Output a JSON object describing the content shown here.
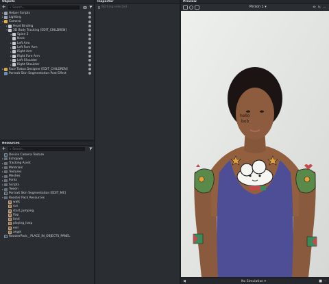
{
  "objects": {
    "title": "Objects",
    "search_placeholder": "Search...",
    "items": [
      {
        "label": "Helper Scripts",
        "indent": 0,
        "arrow": "▸",
        "color": "#9aa4b0"
      },
      {
        "label": "Lighting",
        "indent": 0,
        "arrow": "▸",
        "color": "#9aa4b0"
      },
      {
        "label": "Camera",
        "indent": 0,
        "arrow": "▾",
        "color": "#e0b04a"
      },
      {
        "label": "Head Binding",
        "indent": 1,
        "arrow": "▸",
        "color": "#c6cbd0"
      },
      {
        "label": "3D Body Tracking [EDIT_CHILDREN]",
        "indent": 1,
        "arrow": "▾",
        "color": "#c6cbd0"
      },
      {
        "label": "Spine 2",
        "indent": 2,
        "arrow": "▾",
        "color": "#c6cbd0"
      },
      {
        "label": "Neck",
        "indent": 2,
        "arrow": "",
        "color": "#c6cbd0"
      },
      {
        "label": "Left Arm",
        "indent": 2,
        "arrow": "▸",
        "color": "#c6cbd0"
      },
      {
        "label": "Left Fore Arm",
        "indent": 2,
        "arrow": "▸",
        "color": "#c6cbd0"
      },
      {
        "label": "Right Arm",
        "indent": 2,
        "arrow": "▸",
        "color": "#c6cbd0"
      },
      {
        "label": "Right Fore Arm",
        "indent": 2,
        "arrow": "▸",
        "color": "#c6cbd0"
      },
      {
        "label": "Left Shoulder",
        "indent": 2,
        "arrow": "▸",
        "color": "#c6cbd0"
      },
      {
        "label": "Right Shoulder",
        "indent": 2,
        "arrow": "▸",
        "color": "#c6cbd0"
      },
      {
        "label": "Face Tattoo Designer [EDIT_CHILDREN]",
        "indent": 0,
        "arrow": "▸",
        "color": "#d7a84a"
      },
      {
        "label": "Portrait Skin Segmentation Post Effect",
        "indent": 0,
        "arrow": "",
        "color": "#6b8fb8"
      }
    ]
  },
  "inspector": {
    "title": "Inspector",
    "empty_text": "Nothing selected"
  },
  "resources": {
    "title": "Resources",
    "search_placeholder": "Search...",
    "items": [
      {
        "label": "Device Camera Texture",
        "indent": 0,
        "arrow": "",
        "kind": "file"
      },
      {
        "label": "Echopark",
        "indent": 0,
        "arrow": "▸",
        "kind": "folder"
      },
      {
        "label": "Tracking Asset",
        "indent": 0,
        "arrow": "▸",
        "kind": "folder"
      },
      {
        "label": "Materials",
        "indent": 0,
        "arrow": "▸",
        "kind": "folder"
      },
      {
        "label": "Textures",
        "indent": 0,
        "arrow": "▸",
        "kind": "folder"
      },
      {
        "label": "Meshes",
        "indent": 0,
        "arrow": "▸",
        "kind": "folder"
      },
      {
        "label": "Fonts",
        "indent": 0,
        "arrow": "▸",
        "kind": "folder"
      },
      {
        "label": "Scripts",
        "indent": 0,
        "arrow": "▸",
        "kind": "folder"
      },
      {
        "label": "Tween",
        "indent": 0,
        "arrow": "▸",
        "kind": "folder"
      },
      {
        "label": "Portrait Skin Segmentation [EDIT_ME]",
        "indent": 0,
        "arrow": "",
        "kind": "file"
      },
      {
        "label": "Rooster Pack Resources",
        "indent": 0,
        "arrow": "▾",
        "kind": "folder"
      },
      {
        "label": "walk",
        "indent": 1,
        "arrow": "",
        "kind": "anim"
      },
      {
        "label": "run",
        "indent": 1,
        "arrow": "",
        "kind": "anim"
      },
      {
        "label": "start_jumping",
        "indent": 1,
        "arrow": "",
        "kind": "anim"
      },
      {
        "label": "flap",
        "indent": 1,
        "arrow": "",
        "kind": "anim"
      },
      {
        "label": "land",
        "indent": 1,
        "arrow": "",
        "kind": "anim"
      },
      {
        "label": "playing_harp",
        "indent": 1,
        "arrow": "",
        "kind": "anim"
      },
      {
        "label": "evil",
        "indent": 1,
        "arrow": "",
        "kind": "anim"
      },
      {
        "label": "angel",
        "indent": 1,
        "arrow": "",
        "kind": "anim"
      },
      {
        "label": "RoosterPack__PLACE_IN_OBJECTS_PANEL",
        "indent": 0,
        "arrow": "",
        "kind": "file"
      }
    ]
  },
  "preview": {
    "title": "Preview",
    "person_selector": "Person 1",
    "face_tattoo_text": "hello\nbob",
    "simulation_label": "No Simulation"
  }
}
